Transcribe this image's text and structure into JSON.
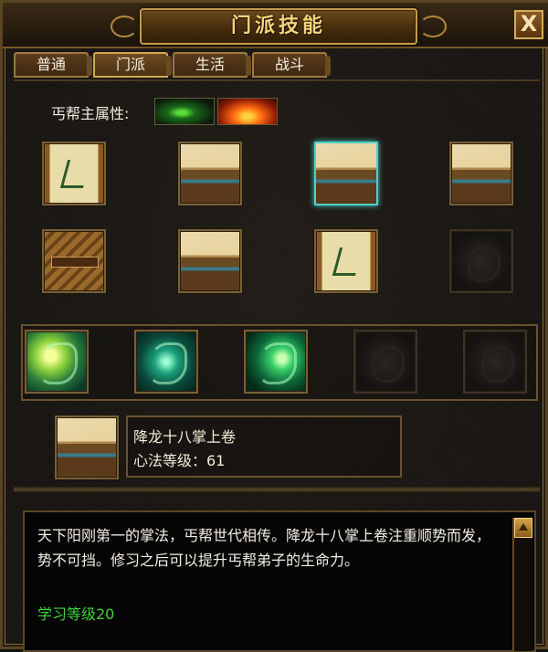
{
  "window": {
    "title": "门派技能",
    "close_label": "X"
  },
  "tabs": [
    {
      "label": "普通"
    },
    {
      "label": "门派"
    },
    {
      "label": "生活"
    },
    {
      "label": "战斗"
    }
  ],
  "attributes": {
    "label": "丐帮主属性:",
    "icons": [
      "poison-attribute-icon",
      "fire-attribute-icon"
    ]
  },
  "skill_grid": {
    "row1": [
      "scroll-icon",
      "book-stack-icon",
      "open-book-icon",
      "book-pile-icon"
    ],
    "row2": [
      "bamboo-bundle-icon",
      "open-book-icon",
      "scroll-icon",
      "empty-slot"
    ],
    "selected": "row1.2"
  },
  "dragon_skills": [
    "golden-dragon-icon",
    "serpent-dragon-icon",
    "dragon-head-icon",
    "empty-slot",
    "empty-slot"
  ],
  "selected_skill": {
    "name": "降龙十八掌上卷",
    "level_text": "心法等级：61"
  },
  "description": {
    "text": "天下阳刚第一的掌法，丐帮世代相传。降龙十八掌上卷注重顺势而发，势不可挡。修习之后可以提升丐帮弟子的生命力。",
    "requirement": "学习等级20"
  },
  "colors": {
    "title": "#f3d47a",
    "requirement": "#3fd23a",
    "selected_border": "#4fd0c8"
  }
}
